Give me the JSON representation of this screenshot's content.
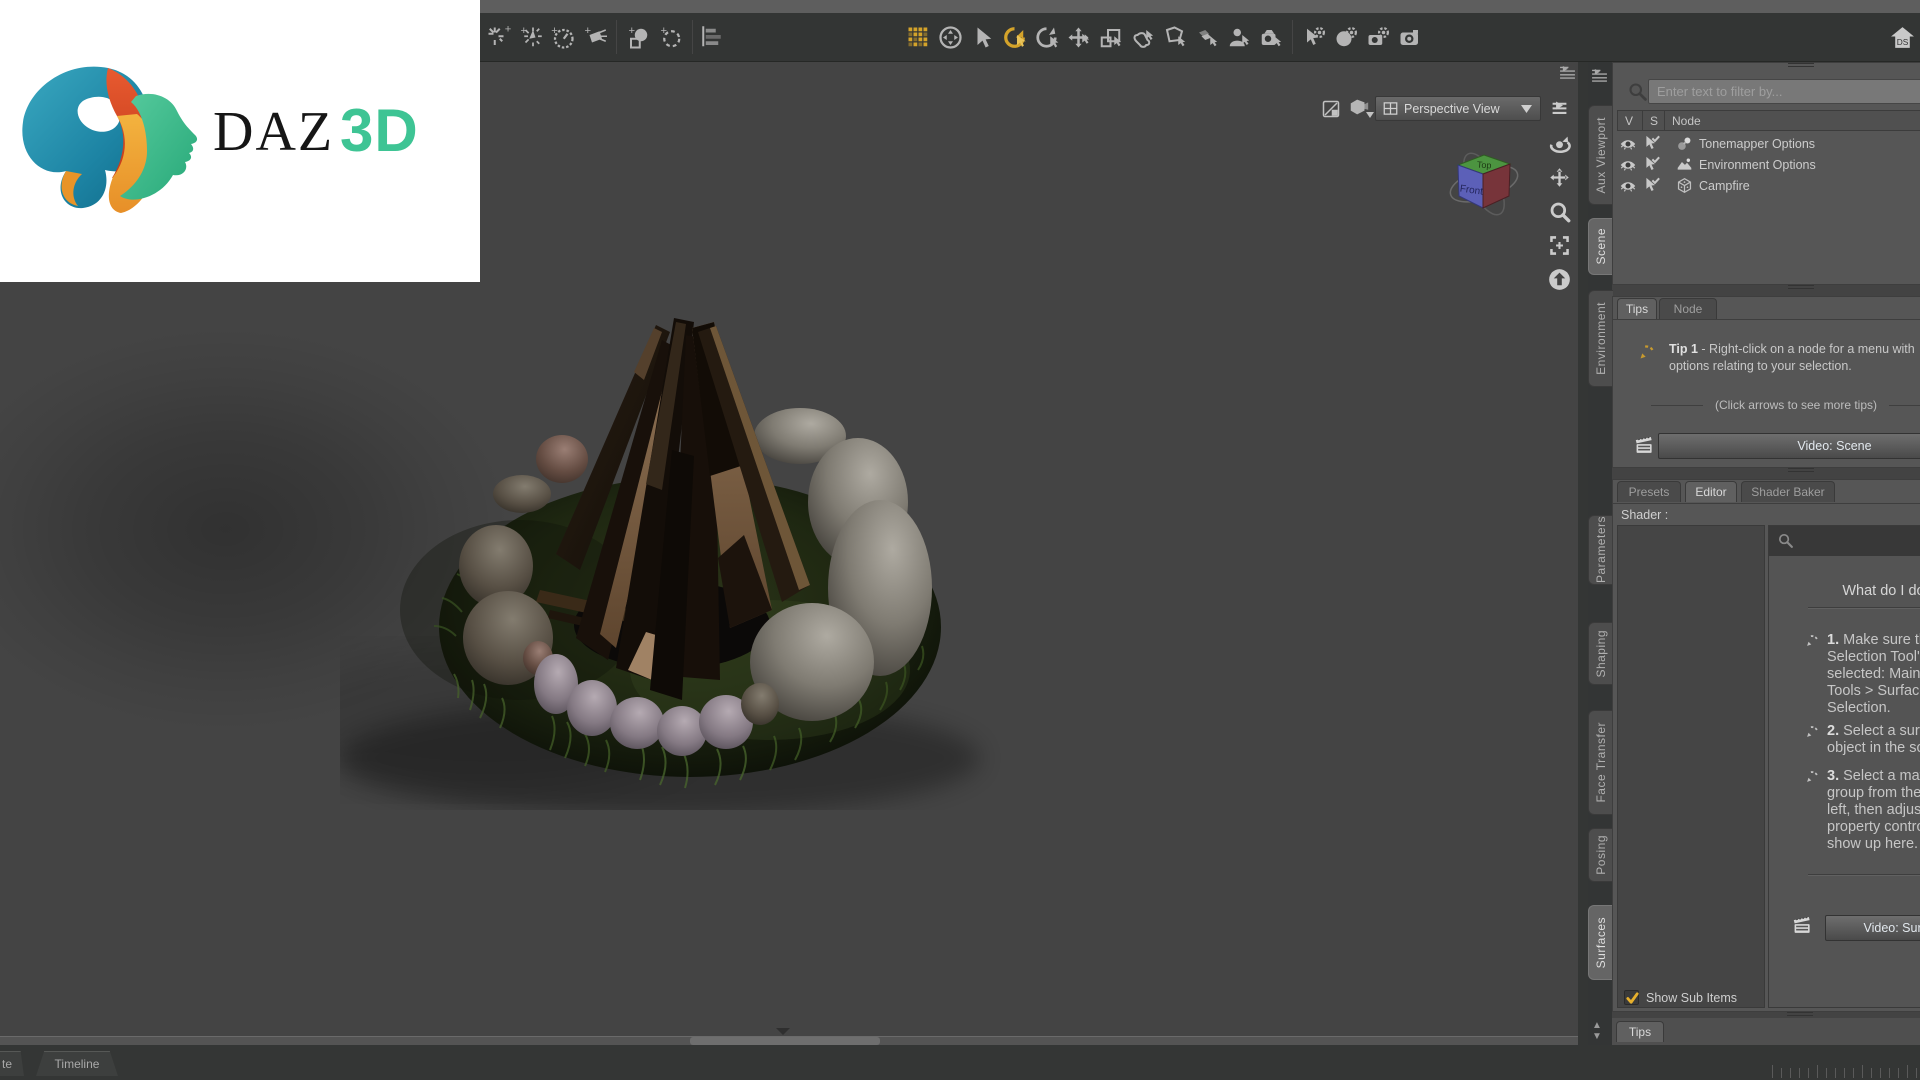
{
  "logo": {
    "daz": "DAZ",
    "threed": "3D"
  },
  "accent_gold": "#d4a32a",
  "toolbar": {
    "left_icons": [
      {
        "name": "create-distant-light-icon"
      },
      {
        "name": "create-point-light-icon"
      },
      {
        "name": "create-gauge-light-icon"
      },
      {
        "name": "create-spotlight-icon"
      },
      {
        "name": "create-primitive-icon",
        "sep_before": true
      },
      {
        "name": "create-group-icon"
      },
      {
        "name": "scene-list-icon",
        "sep_before": true
      }
    ],
    "mid_icons": [
      {
        "name": "viewport-grid-tool-icon",
        "gold": true
      },
      {
        "name": "orbit-tool-icon"
      },
      {
        "name": "node-selection-tool-icon"
      },
      {
        "name": "universal-rotate-tool-icon",
        "gold": true
      },
      {
        "name": "rotate-tool-icon"
      },
      {
        "name": "translate-tool-icon"
      },
      {
        "name": "scale-tool-icon"
      },
      {
        "name": "joint-editor-tool-icon"
      },
      {
        "name": "geometry-editor-tool-icon"
      },
      {
        "name": "surface-selection-tool-icon"
      },
      {
        "name": "figure-setup-tool-icon"
      },
      {
        "name": "camera-tool-icon"
      },
      {
        "name": "node-gear-tool-icon",
        "sep_before": true
      },
      {
        "name": "sphere-gear-tool-icon"
      },
      {
        "name": "camera-gear-tool-icon"
      },
      {
        "name": "render-camera-icon"
      }
    ],
    "home_badge": "DS"
  },
  "viewport": {
    "view_dropdown": "Perspective View",
    "cube": {
      "top_label": "Top",
      "front_label": "Front"
    },
    "nav_icons": [
      "pane-menu-icon",
      "orbit-view-icon",
      "pan-view-icon",
      "zoom-view-icon",
      "frame-view-icon",
      "home-view-icon"
    ]
  },
  "dock": {
    "top_tabs": [
      {
        "label": "Aux Viewport",
        "active": false
      },
      {
        "label": "Scene",
        "active": true
      },
      {
        "label": "Environment",
        "active": false
      }
    ],
    "bottom_tabs": [
      {
        "label": "Parameters",
        "active": false
      },
      {
        "label": "Shaping",
        "active": false
      },
      {
        "label": "Face Transfer",
        "active": false
      },
      {
        "label": "Posing",
        "active": false
      },
      {
        "label": "Surfaces",
        "active": true
      }
    ],
    "scene": {
      "filter_placeholder": "Enter text to filter by...",
      "columns": [
        "V",
        "S",
        "Node"
      ],
      "nodes": [
        {
          "label": "Tonemapper Options",
          "icon": "tonemapper-icon"
        },
        {
          "label": "Environment Options",
          "icon": "environment-icon"
        },
        {
          "label": "Campfire",
          "icon": "node-cube-icon"
        }
      ]
    },
    "tips": {
      "tabs": [
        {
          "label": "Tips",
          "active": true
        },
        {
          "label": "Node",
          "active": false
        }
      ],
      "tip_bold": "Tip 1",
      "tip_text": " - Right-click on a node for a menu with options relating to your selection.",
      "more_label": "(Click arrows to see more tips)",
      "video_button": "Video: Scene"
    },
    "editor": {
      "tabs": [
        {
          "label": "Presets",
          "active": false
        },
        {
          "label": "Editor",
          "active": true
        },
        {
          "label": "Shader Baker",
          "active": false
        }
      ],
      "shader_label": "Shader :",
      "show_sub_items": "Show Sub Items",
      "video_button": "Video: Surfaces",
      "help": {
        "heading": "What do I do?",
        "steps": [
          {
            "num": "1.",
            "text": " Make sure the 'Surface Selection Tool' is selected: Main Menu > Tools > Surface Selection."
          },
          {
            "num": "2.",
            "text": " Select a surface of an object in the scene."
          },
          {
            "num": "3.",
            "text": " Select a material group from the list on the left, then adjust the property controls that show up here."
          }
        ]
      }
    },
    "bottom_tab": "Tips"
  },
  "bottom_bar": {
    "tabs": [
      "te",
      "Timeline"
    ]
  }
}
